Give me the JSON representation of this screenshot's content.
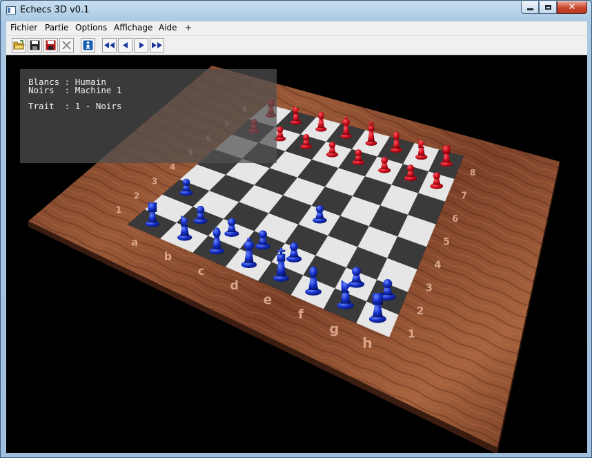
{
  "window": {
    "title": "Echecs 3D v0.1",
    "close_glyph": "✕"
  },
  "menu": [
    "Fichier",
    "Partie",
    "Options",
    "Affichage",
    "Aide",
    "+"
  ],
  "toolbar": {
    "buttons": [
      "open-folder-icon",
      "save-icon",
      "save-as-icon",
      "close-x-icon",
      "player-icon",
      "first-move-icon",
      "previous-move-icon",
      "next-move-icon",
      "last-move-icon"
    ]
  },
  "hud": {
    "blancs": "Blancs : Humain",
    "noirs": "Noirs  : Machine 1",
    "trait": "Trait  : 1 - Noirs"
  },
  "board": {
    "files": [
      "a",
      "b",
      "c",
      "d",
      "e",
      "f",
      "g",
      "h"
    ],
    "near_ranks": [
      "1",
      "2",
      "3",
      "4",
      "5",
      "6",
      "7",
      "8"
    ],
    "far_ranks": [
      "1",
      "2",
      "3",
      "4",
      "5",
      "6",
      "7",
      "8"
    ],
    "colors": {
      "red_pieces": "#d0101e",
      "blue_pieces": "#1530c8",
      "wood": "#8a4a2c",
      "light_square": "#e6e6e6",
      "dark_square": "#3a3a3a"
    },
    "pieces": [
      {
        "color": "blue",
        "type": "pawn",
        "square": "b2"
      },
      {
        "color": "blue",
        "type": "pawn",
        "square": "c2"
      },
      {
        "color": "blue",
        "type": "pawn",
        "square": "d2"
      },
      {
        "color": "blue",
        "type": "pawn",
        "square": "e2"
      },
      {
        "color": "blue",
        "type": "pawn",
        "square": "g2"
      },
      {
        "color": "blue",
        "type": "pawn",
        "square": "h2"
      },
      {
        "color": "blue",
        "type": "pawn",
        "square": "e4"
      },
      {
        "color": "blue",
        "type": "pawn",
        "square": "a3"
      },
      {
        "color": "blue",
        "type": "rook",
        "square": "a1"
      },
      {
        "color": "blue",
        "type": "knight",
        "square": "b1"
      },
      {
        "color": "blue",
        "type": "bishop",
        "square": "c1"
      },
      {
        "color": "blue",
        "type": "queen",
        "square": "d1"
      },
      {
        "color": "blue",
        "type": "king",
        "square": "e1"
      },
      {
        "color": "blue",
        "type": "bishop",
        "square": "f1"
      },
      {
        "color": "blue",
        "type": "knight",
        "square": "g1"
      },
      {
        "color": "blue",
        "type": "rook",
        "square": "h1"
      },
      {
        "color": "red",
        "type": "pawn",
        "square": "a7"
      },
      {
        "color": "red",
        "type": "pawn",
        "square": "b7"
      },
      {
        "color": "red",
        "type": "pawn",
        "square": "c7"
      },
      {
        "color": "red",
        "type": "pawn",
        "square": "d7"
      },
      {
        "color": "red",
        "type": "pawn",
        "square": "e7"
      },
      {
        "color": "red",
        "type": "pawn",
        "square": "f7"
      },
      {
        "color": "red",
        "type": "pawn",
        "square": "g7"
      },
      {
        "color": "red",
        "type": "pawn",
        "square": "h7"
      },
      {
        "color": "red",
        "type": "rook",
        "square": "a8"
      },
      {
        "color": "red",
        "type": "knight",
        "square": "b8"
      },
      {
        "color": "red",
        "type": "bishop",
        "square": "c8"
      },
      {
        "color": "red",
        "type": "queen",
        "square": "d8"
      },
      {
        "color": "red",
        "type": "king",
        "square": "e8"
      },
      {
        "color": "red",
        "type": "bishop",
        "square": "f8"
      },
      {
        "color": "red",
        "type": "knight",
        "square": "g8"
      },
      {
        "color": "red",
        "type": "rook",
        "square": "h8"
      }
    ]
  }
}
